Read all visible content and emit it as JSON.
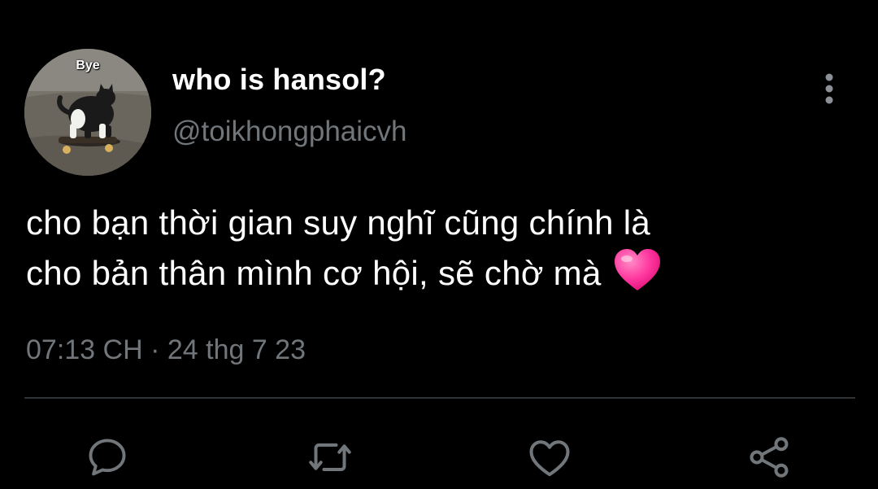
{
  "user": {
    "display_name": "who is hansol?",
    "handle": "@toikhongphaicvh",
    "avatar_caption": "Bye"
  },
  "tweet": {
    "text_line1": "cho bạn thời gian suy nghĩ cũng chính là",
    "text_line2": "cho bản thân mình cơ hội, sẽ chờ mà",
    "emoji": "pink-heart-icon",
    "timestamp": "07:13 CH · 24 thg 7 23"
  },
  "actions": [
    "reply-icon",
    "retweet-icon",
    "like-icon",
    "share-icon"
  ],
  "colors": {
    "background": "#000000",
    "text": "#ffffff",
    "secondary": "#71767b",
    "divider": "#2f3336",
    "heart": "#ff2d95"
  }
}
